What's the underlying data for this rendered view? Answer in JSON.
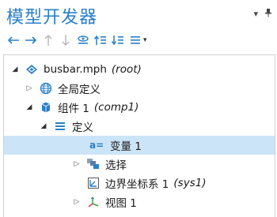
{
  "panel": {
    "title": "模型开发器",
    "menu_glyph": "▾",
    "pin_glyph": "▪"
  },
  "toolbar": {
    "buttons": [
      "back-arrow",
      "forward-arrow",
      "move-up",
      "move-down",
      "show",
      "collapse-all",
      "expand-all",
      "model-tree-node-text"
    ],
    "dropdown_glyph": "▾"
  },
  "tree": {
    "root": {
      "label": "busbar.mph",
      "tag": "(root)"
    },
    "global_definitions": {
      "label": "全局定义"
    },
    "component": {
      "label": "组件 1",
      "tag": "(comp1)"
    },
    "definitions": {
      "label": "定义"
    },
    "variables": {
      "label": "变量 1",
      "icon_text": "a="
    },
    "selections": {
      "label": "选择"
    },
    "boundary_system": {
      "label": "边界坐标系 1",
      "tag": "(sys1)"
    },
    "view": {
      "label": "视图 1"
    }
  },
  "colors": {
    "title": "#2a7fc9",
    "selected_row": "#cce4f7",
    "accent_blue": "#2a7fc9"
  }
}
